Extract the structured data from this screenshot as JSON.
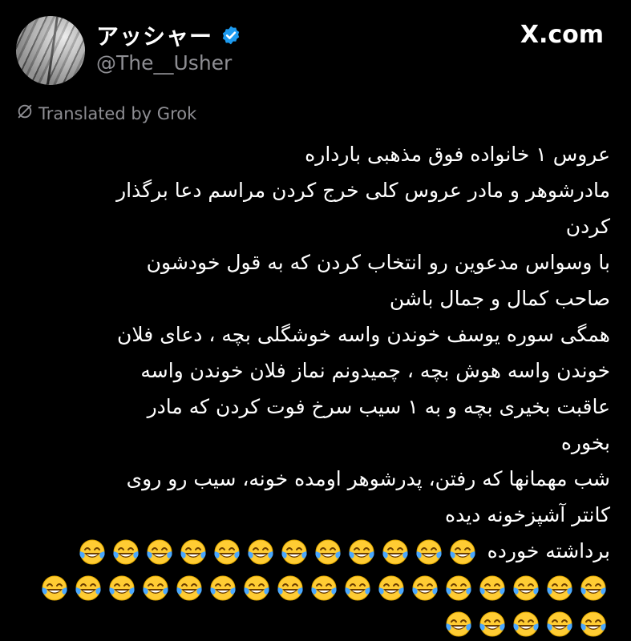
{
  "author": {
    "display_name": "アッシャー",
    "handle": "@The__Usher"
  },
  "brand": {
    "site_label": "X.com"
  },
  "translation": {
    "label": "Translated by Grok"
  },
  "tweet": {
    "lines": [
      "عروس ۱ خانواده فوق مذهبی بارداره",
      "مادرشوهر و مادر عروس کلی خرج کردن مراسم دعا برگذار",
      "کردن",
      "با وسواس مدعوین رو انتخاب کردن که به قول خودشون",
      "صاحب کمال و جمال باشن",
      "همگی سوره یوسف خوندن واسه خوشگلی بچه ، دعای فلان",
      "خوندن واسه هوش بچه ، چمیدونم نماز فلان خوندن واسه",
      "عاقبت بخیری بچه و به ۱ سیب سرخ فوت کردن که مادر",
      "بخوره",
      "شب مهمانها که رفتن، پدرشوهر اومده خونه، سیب رو روی",
      "کانتر آشپزخونه دیده",
      "برداشته خورده"
    ],
    "emoji_name": "face-with-tears-of-joy",
    "emoji_counts": [
      12,
      17,
      5
    ]
  },
  "colors": {
    "background": "#000000",
    "secondary_text": "#8e8e93",
    "verified_blue": "#1d9bf0",
    "emoji_yellow": "#ffcc33"
  }
}
